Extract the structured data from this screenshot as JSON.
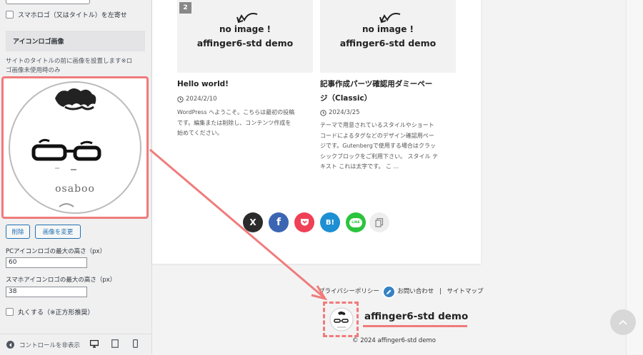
{
  "panel": {
    "smartphone_logo_left": "スマホロゴ（又はタイトル）を左寄せ",
    "section_title": "アイコンロゴ画像",
    "description_line1": "サイトのタイトルの前に画像を設置します※ロ",
    "description_line2": "ゴ画像未使用時のみ",
    "logo_text": "osaboo",
    "remove_label": "削除",
    "change_label": "画像を変更",
    "pc_height_label": "PCアイコンロゴの最大の高さ（px）",
    "pc_height_value": "60",
    "sp_height_label": "スマホアイコンロゴの最大の高さ（px）",
    "sp_height_value": "38",
    "round_label": "丸くする（※正方形推奨）",
    "hide_controls_label": "コントロールを非表示"
  },
  "preview": {
    "post1": {
      "badge": "2",
      "noimage_line1": "no image !",
      "noimage_line2": "affinger6-std demo",
      "title": "Hello world!",
      "date": "2024/2/10",
      "excerpt": [
        "WordPress へようこそ。こちらは最初の投稿",
        "です。編集または削除し、コンテンツ作成を",
        "始めてください。"
      ]
    },
    "post2": {
      "noimage_line1": "no image !",
      "noimage_line2": "affinger6-std demo",
      "title_line1": "記事作成パーツ確認用ダミーペー",
      "title_line2": "ジ（Classic）",
      "date": "2024/3/25",
      "excerpt": [
        "テーマで用意されているスタイルやショート",
        "コードによるタグなどのデザイン確認用ペー",
        "ジです。Gutenbergで使用する場合はクラッ",
        "シックブロックをご利用下さい。 スタイル テ",
        "キスト これは太字です。 こ ..."
      ]
    },
    "share": {
      "x": "X",
      "facebook": "f",
      "hatena": "B!",
      "line": "LINE"
    },
    "footer": {
      "privacy": "プライバシーポリシー",
      "contact": "お問い合わせ",
      "separator": "|",
      "sitemap": "サイトマップ",
      "site_title": "affinger6-std demo",
      "copyright": "© 2024 affinger6-std demo"
    }
  },
  "colors": {
    "highlight": "#f07b7b",
    "x": "#2b2b2b",
    "facebook": "#3b65b3",
    "pocket": "#ef4056",
    "hatena": "#1d8fd2",
    "line": "#2ac43d",
    "copy": "#eeeeee"
  }
}
